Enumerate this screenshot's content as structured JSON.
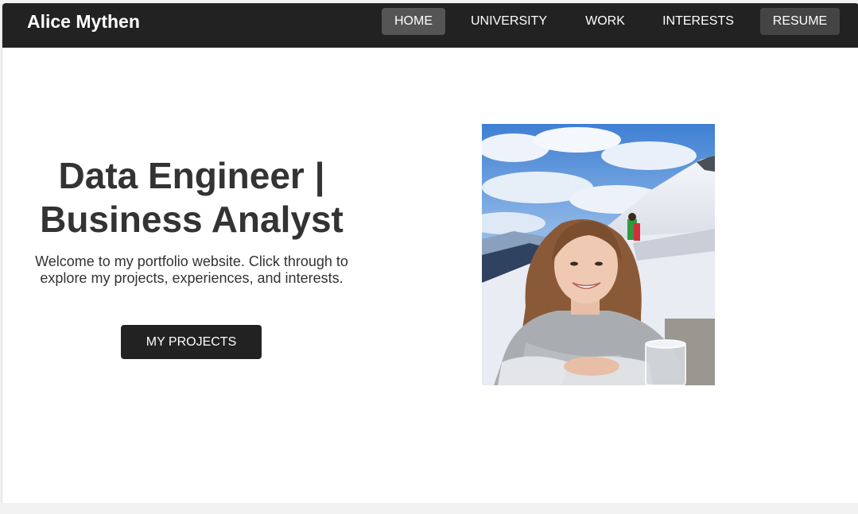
{
  "navbar": {
    "brand": "Alice Mythen",
    "links": [
      {
        "label": "HOME",
        "state": "active"
      },
      {
        "label": "UNIVERSITY",
        "state": "normal"
      },
      {
        "label": "WORK",
        "state": "normal"
      },
      {
        "label": "INTERESTS",
        "state": "normal"
      },
      {
        "label": "RESUME",
        "state": "boxed"
      }
    ]
  },
  "hero": {
    "title_line1": "Data Engineer |",
    "title_line2": "Business Analyst",
    "intro": "Welcome to my portfolio website. Click through to explore my projects, experiences, and interests.",
    "cta_label": "MY PROJECTS"
  },
  "colors": {
    "navbar_bg": "#222222",
    "nav_active_bg": "#555555",
    "nav_boxed_bg": "#444444",
    "text": "#333333",
    "button_bg": "#222222",
    "page_bg": "#ffffff"
  }
}
